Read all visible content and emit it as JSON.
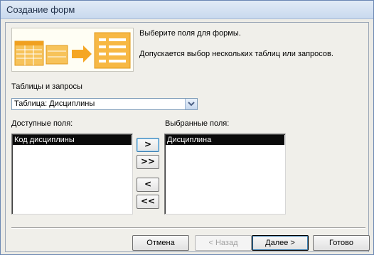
{
  "window": {
    "title": "Создание форм"
  },
  "header": {
    "instruction": "Выберите поля для формы.",
    "hint": "Допускается выбор нескольких таблиц или запросов."
  },
  "source": {
    "label": "Таблицы и запросы",
    "selected": "Таблица: Дисциплины"
  },
  "available": {
    "label": "Доступные поля:",
    "items": [
      "Код дисциплины"
    ]
  },
  "selected_fields": {
    "label": "Выбранные поля:",
    "items": [
      "Дисциплина"
    ]
  },
  "move_buttons": {
    "add_one": ">",
    "add_all": ">>",
    "remove_one": "<",
    "remove_all": "<<"
  },
  "footer": {
    "cancel": "Отмена",
    "back": "< Назад",
    "next": "Далее >",
    "finish": "Готово"
  },
  "colors": {
    "banner_orange": "#f5a623",
    "list_highlight": "#0a0a0a"
  }
}
